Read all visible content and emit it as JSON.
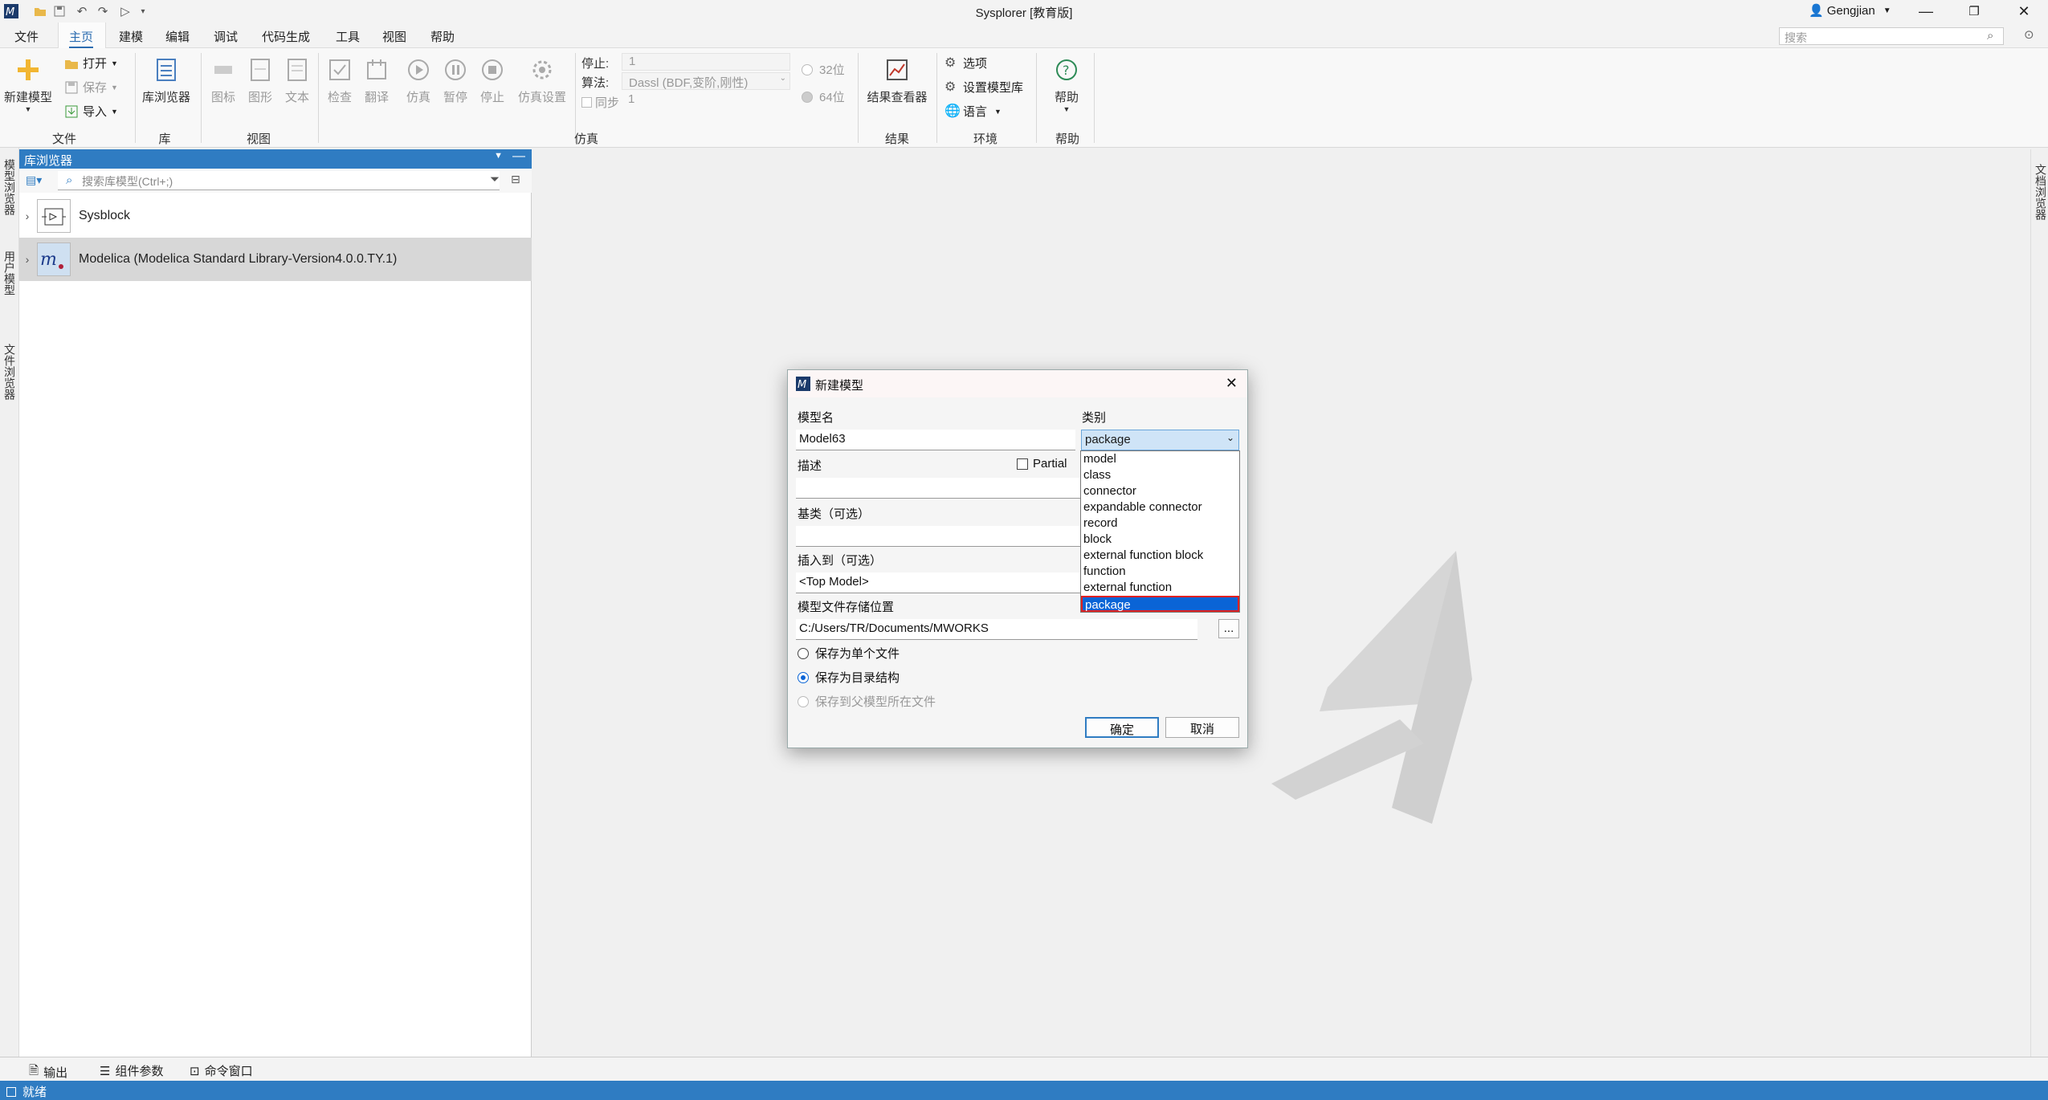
{
  "window": {
    "title": "Sysplorer [教育版]",
    "user": "Gengjian"
  },
  "menu": {
    "items": [
      "文件",
      "主页",
      "建模",
      "编辑",
      "调试",
      "代码生成",
      "工具",
      "视图",
      "帮助"
    ],
    "active": "主页"
  },
  "search": {
    "placeholder": "搜索"
  },
  "ribbon": {
    "file": {
      "new_model": "新建模型",
      "open": "打开",
      "save": "保存",
      "import": "导入",
      "label": "文件"
    },
    "library": {
      "browser": "库浏览器",
      "label": "库"
    },
    "view": {
      "icon": "图标",
      "diagram": "图形",
      "text": "文本",
      "label": "视图"
    },
    "sim": {
      "check": "检查",
      "translate": "翻译",
      "simulate": "仿真",
      "pause": "暂停",
      "stop": "停止",
      "settings": "仿真设置",
      "label": "仿真",
      "stop_time_label": "停止:",
      "stop_time": "1",
      "algo_label": "算法:",
      "algo": "Dassl (BDF,变阶,刚性)",
      "sync_label": "同步",
      "sync_value": "1",
      "bit32": "32位",
      "bit64": "64位"
    },
    "result": {
      "viewer": "结果查看器",
      "label": "结果"
    },
    "env": {
      "options": "选项",
      "set_lib": "设置模型库",
      "language": "语言",
      "label": "环境"
    },
    "help": {
      "help": "帮助",
      "label": "帮助"
    }
  },
  "side_tabs": {
    "left": [
      "模型浏览器",
      "用户模型",
      "文件浏览器"
    ],
    "right": [
      "文档浏览器"
    ]
  },
  "library_browser": {
    "title": "库浏览器",
    "search_placeholder": "搜索库模型(Ctrl+;)",
    "items": [
      {
        "label": "Sysblock"
      },
      {
        "label": "Modelica (Modelica Standard Library-Version4.0.0.TY.1)"
      }
    ]
  },
  "bottom_tabs": [
    "输出",
    "组件参数",
    "命令窗口"
  ],
  "status": "就绪",
  "dialog": {
    "title": "新建模型",
    "model_name_label": "模型名",
    "model_name": "Model63",
    "category_label": "类别",
    "category_value": "package",
    "desc_label": "描述",
    "partial_label": "Partial",
    "base_label": "基类（可选）",
    "insert_label": "插入到（可选）",
    "insert_value": "<Top Model>",
    "path_label": "模型文件存储位置",
    "path_value": "C:/Users/TR/Documents/MWORKS",
    "browse_label": "...",
    "save_single": "保存为单个文件",
    "save_dir": "保存为目录结构",
    "save_parent": "保存到父模型所在文件",
    "ok": "确定",
    "cancel": "取消",
    "options": [
      "model",
      "class",
      "connector",
      "expandable connector",
      "record",
      "block",
      "external function block",
      "function",
      "external function",
      "package"
    ],
    "selected_option": "package"
  },
  "colors": {
    "accent": "#2f7cc2",
    "selection": "#0a64d6",
    "highlight_border": "#e02020"
  }
}
